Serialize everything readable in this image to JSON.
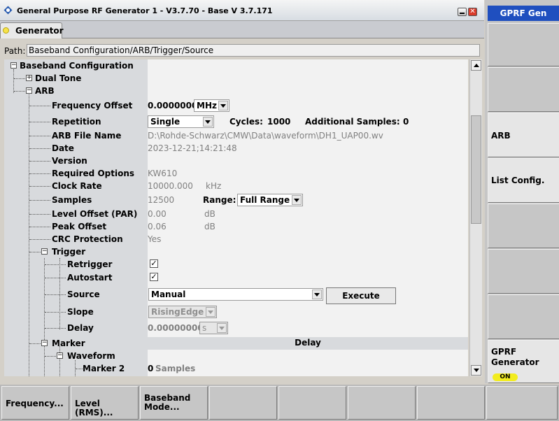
{
  "window": {
    "title": "General Purpose RF Generator 1 - V3.7.70 - Base V 3.7.171",
    "tab": "Generator"
  },
  "path": {
    "label": "Path:",
    "value": "Baseband Configuration/ARB/Trigger/Source"
  },
  "tree": {
    "baseband_configuration": "Baseband Configuration",
    "dual_tone": "Dual Tone",
    "arb": "ARB",
    "frequency_offset": {
      "label": "Frequency Offset",
      "value": "0.0000000",
      "unit": "MHz"
    },
    "repetition": {
      "label": "Repetition",
      "value": "Single",
      "cycles_label": "Cycles:",
      "cycles_value": "1000",
      "add_samples_label": "Additional Samples:",
      "add_samples_value": "0"
    },
    "arb_file_name": {
      "label": "ARB File Name",
      "value": "D:\\Rohde-Schwarz\\CMW\\Data\\waveform\\DH1_UAP00.wv"
    },
    "date": {
      "label": "Date",
      "value": "2023-12-21;14:21:48"
    },
    "version": {
      "label": "Version",
      "value": ""
    },
    "required_options": {
      "label": "Required Options",
      "value": "KW610"
    },
    "clock_rate": {
      "label": "Clock Rate",
      "value": "10000.000",
      "unit": "kHz"
    },
    "samples": {
      "label": "Samples",
      "value": "12500",
      "range_label": "Range:",
      "range_value": "Full Range"
    },
    "level_offset": {
      "label": "Level Offset (PAR)",
      "value": "0.00",
      "unit": "dB"
    },
    "peak_offset": {
      "label": "Peak Offset",
      "value": "0.06",
      "unit": "dB"
    },
    "crc_protection": {
      "label": "CRC Protection",
      "value": "Yes"
    },
    "trigger": "Trigger",
    "retrigger": {
      "label": "Retrigger",
      "checked": true,
      "mark": "✓"
    },
    "autostart": {
      "label": "Autostart",
      "checked": true,
      "mark": "✓"
    },
    "source": {
      "label": "Source",
      "value": "Manual",
      "execute": "Execute"
    },
    "slope": {
      "label": "Slope",
      "value": "RisingEdge"
    },
    "delay": {
      "label": "Delay",
      "value": "0.00000000",
      "unit": "s"
    },
    "marker": "Marker",
    "delay_header": "Delay",
    "waveform": "Waveform",
    "marker2": {
      "label": "Marker 2",
      "value": "0",
      "unit": "Samples"
    }
  },
  "tree_glyphs": {
    "minus": "−",
    "plus": "+"
  },
  "right_panel": {
    "title": "GPRF Gen",
    "arb": "ARB",
    "list_config": "List Config.",
    "gprf_generator": "GPRF Generator",
    "on": "ON"
  },
  "bottom": {
    "frequency": "Frequency...",
    "level": "Level (RMS)...",
    "baseband": "Baseband\nMode..."
  },
  "colors": {
    "accent_blue": "#1f4fbf",
    "on_yellow": "#f2ec1f",
    "close_red": "#d93b2b"
  }
}
